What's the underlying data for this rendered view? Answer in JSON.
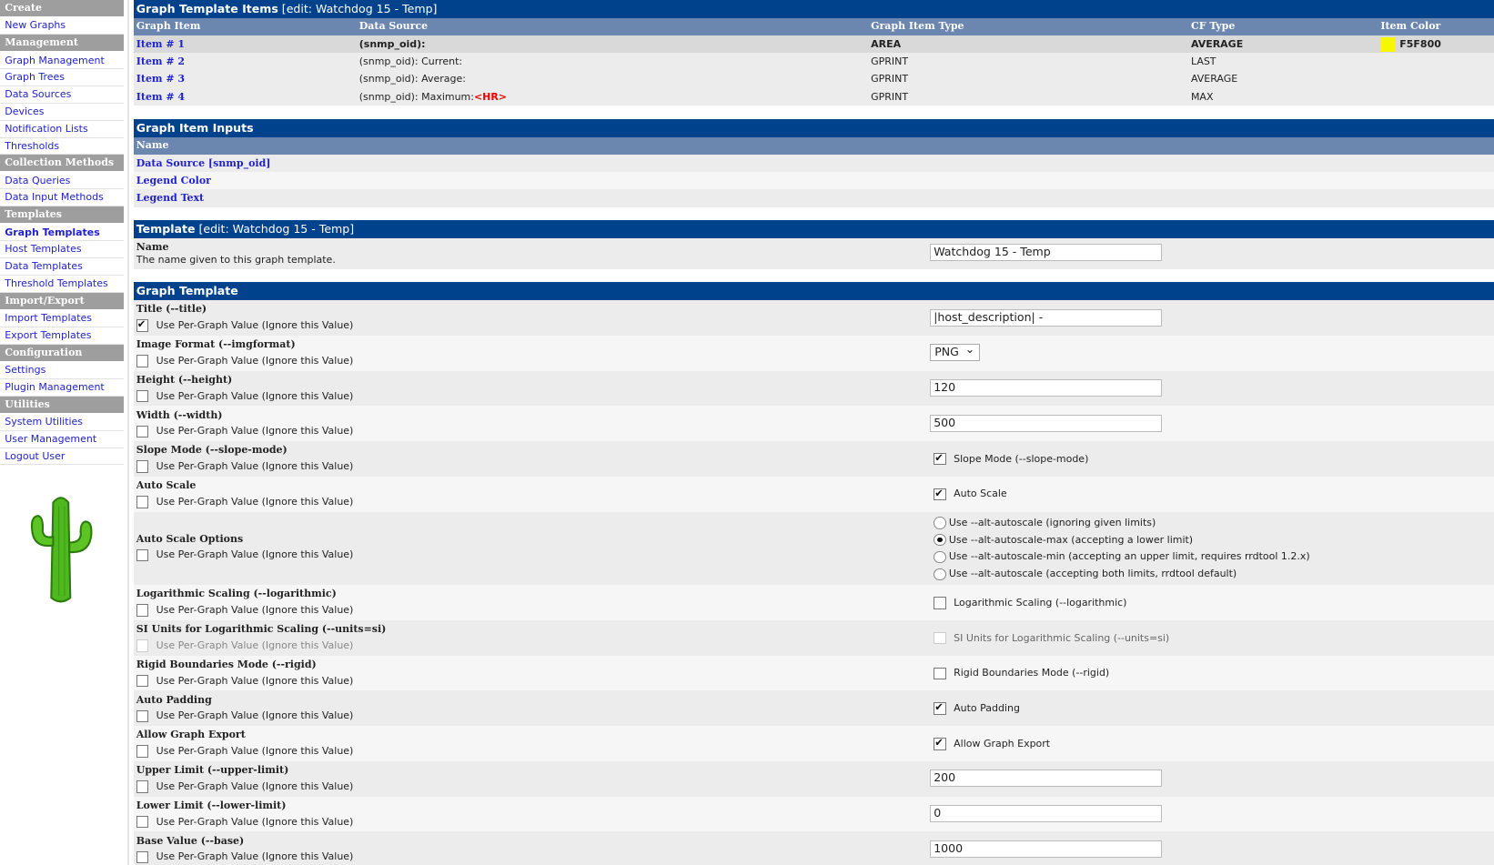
{
  "sidebar": {
    "sections": [
      {
        "header": "Create",
        "items": [
          "New Graphs"
        ]
      },
      {
        "header": "Management",
        "items": [
          "Graph Management",
          "Graph Trees",
          "Data Sources",
          "Devices",
          "Notification Lists",
          "Thresholds"
        ]
      },
      {
        "header": "Collection Methods",
        "items": [
          "Data Queries",
          "Data Input Methods"
        ]
      },
      {
        "header": "Templates",
        "items": [
          "Graph Templates",
          "Host Templates",
          "Data Templates",
          "Threshold Templates"
        ]
      },
      {
        "header": "Import/Export",
        "items": [
          "Import Templates",
          "Export Templates"
        ]
      },
      {
        "header": "Configuration",
        "items": [
          "Settings",
          "Plugin Management"
        ]
      },
      {
        "header": "Utilities",
        "items": [
          "System Utilities",
          "User Management",
          "Logout User"
        ]
      }
    ],
    "active": "Graph Templates"
  },
  "items": {
    "title": "Graph Template Items",
    "edit": "[edit: Watchdog 15 - Temp]",
    "columns": [
      "Graph Item",
      "Data Source",
      "Graph Item Type",
      "CF Type",
      "Item Color"
    ],
    "rows": [
      {
        "item": "Item # 1",
        "source": "(snmp_oid):",
        "hr": "",
        "type": "AREA",
        "cf": "AVERAGE",
        "color": "F5F800",
        "color_hex": "#F5F800"
      },
      {
        "item": "Item # 2",
        "source": "(snmp_oid): Current:",
        "hr": "",
        "type": "GPRINT",
        "cf": "LAST",
        "color": "",
        "color_hex": ""
      },
      {
        "item": "Item # 3",
        "source": "(snmp_oid): Average:",
        "hr": "",
        "type": "GPRINT",
        "cf": "AVERAGE",
        "color": "",
        "color_hex": ""
      },
      {
        "item": "Item # 4",
        "source": "(snmp_oid): Maximum:",
        "hr": "<HR>",
        "type": "GPRINT",
        "cf": "MAX",
        "color": "",
        "color_hex": ""
      }
    ]
  },
  "inputs": {
    "title": "Graph Item Inputs",
    "column": "Name",
    "rows": [
      "Data Source [snmp_oid]",
      "Legend Color",
      "Legend Text"
    ]
  },
  "template": {
    "title": "Template",
    "edit": "[edit: Watchdog 15 - Temp]",
    "name_label": "Name",
    "name_desc": "The name given to this graph template.",
    "name_value": "Watchdog 15 - Temp"
  },
  "graph": {
    "title": "Graph Template",
    "per_graph": "Use Per-Graph Value (Ignore this Value)",
    "fields": [
      {
        "label": "Title (--title)",
        "per": true,
        "kind": "text",
        "value": "|host_description| -"
      },
      {
        "label": "Image Format (--imgformat)",
        "per": false,
        "kind": "select",
        "value": "PNG"
      },
      {
        "label": "Height (--height)",
        "per": false,
        "kind": "text",
        "value": "120"
      },
      {
        "label": "Width (--width)",
        "per": false,
        "kind": "text",
        "value": "500"
      },
      {
        "label": "Slope Mode (--slope-mode)",
        "per": false,
        "kind": "check",
        "checked": true,
        "text": "Slope Mode (--slope-mode)"
      },
      {
        "label": "Auto Scale",
        "per": false,
        "kind": "check",
        "checked": true,
        "text": "Auto Scale"
      },
      {
        "label": "Auto Scale Options",
        "per": false,
        "kind": "radio",
        "options": [
          "Use --alt-autoscale (ignoring given limits)",
          "Use --alt-autoscale-max (accepting a lower limit)",
          "Use --alt-autoscale-min (accepting an upper limit, requires rrdtool 1.2.x)",
          "Use --alt-autoscale (accepting both limits, rrdtool default)"
        ],
        "selected": 1
      },
      {
        "label": "Logarithmic Scaling (--logarithmic)",
        "per": false,
        "kind": "check",
        "checked": false,
        "text": "Logarithmic Scaling (--logarithmic)"
      },
      {
        "label": "SI Units for Logarithmic Scaling (--units=si)",
        "per": false,
        "disabled": true,
        "kind": "check",
        "checked": false,
        "text": "SI Units for Logarithmic Scaling (--units=si)"
      },
      {
        "label": "Rigid Boundaries Mode (--rigid)",
        "per": false,
        "kind": "check",
        "checked": false,
        "text": "Rigid Boundaries Mode (--rigid)"
      },
      {
        "label": "Auto Padding",
        "per": false,
        "kind": "check",
        "checked": true,
        "text": "Auto Padding"
      },
      {
        "label": "Allow Graph Export",
        "per": false,
        "kind": "check",
        "checked": true,
        "text": "Allow Graph Export"
      },
      {
        "label": "Upper Limit (--upper-limit)",
        "per": false,
        "kind": "text",
        "value": "200"
      },
      {
        "label": "Lower Limit (--lower-limit)",
        "per": false,
        "kind": "text",
        "value": "0"
      },
      {
        "label": "Base Value (--base)",
        "per": false,
        "kind": "text",
        "value": "1000"
      }
    ]
  },
  "colors": {
    "title_bar": "#00438c",
    "header_bar": "#6b87b0",
    "link": "#2222cc"
  }
}
